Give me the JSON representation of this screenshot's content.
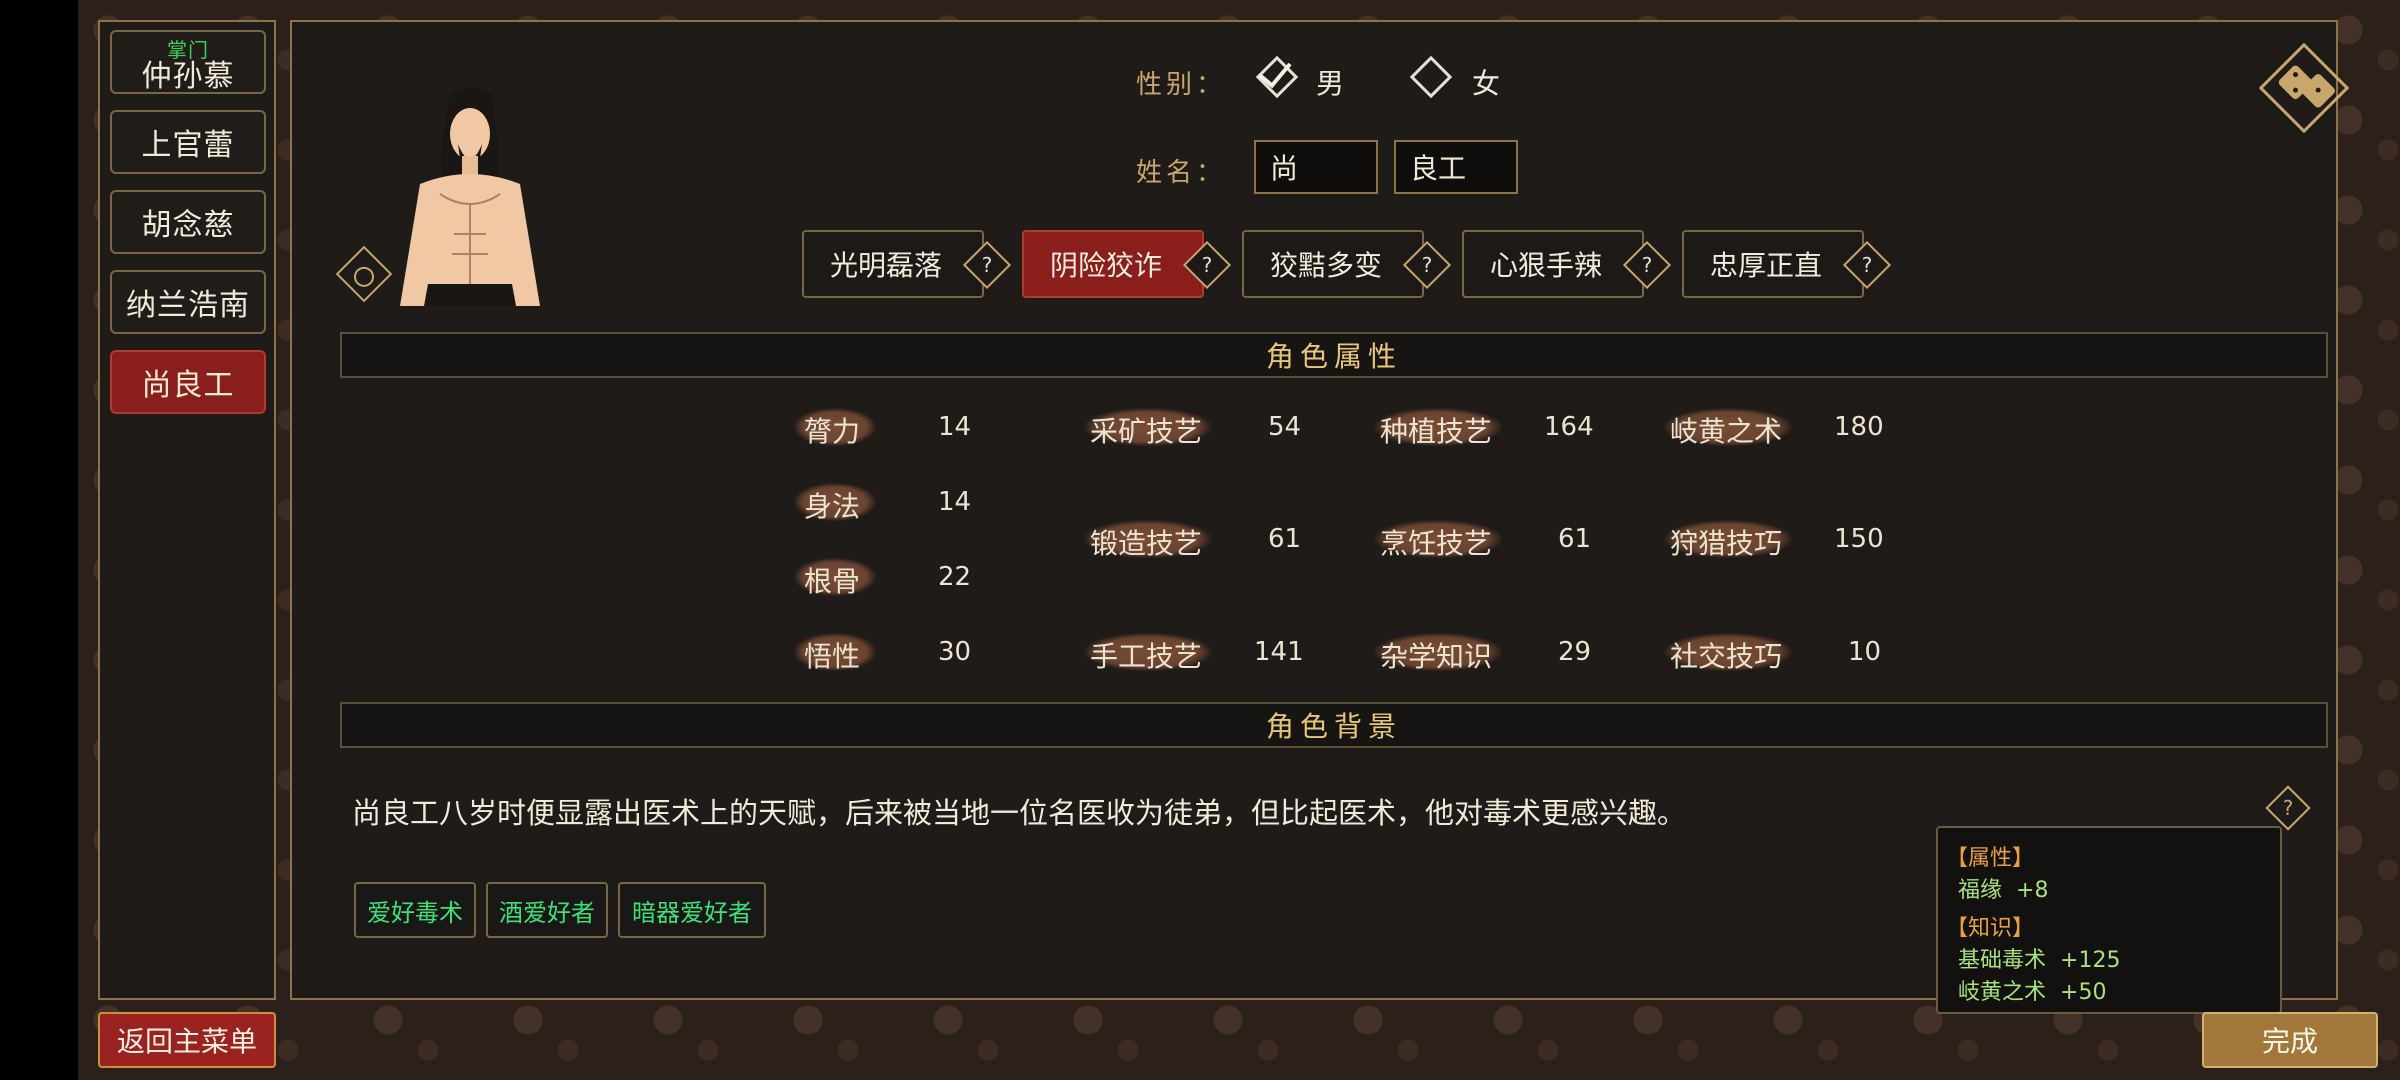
{
  "sidebar": {
    "items": [
      {
        "label": "仲孙慕",
        "tag": "掌门"
      },
      {
        "label": "上官蕾"
      },
      {
        "label": "胡念慈"
      },
      {
        "label": "纳兰浩南"
      },
      {
        "label": "尚良工",
        "active": true
      }
    ]
  },
  "buttons": {
    "back": "返回主菜单",
    "done": "完成"
  },
  "gender": {
    "label": "性别：",
    "options": [
      "男",
      "女"
    ],
    "selected": "男"
  },
  "name": {
    "label": "姓名：",
    "surname": "尚",
    "given": "良工"
  },
  "traits": [
    {
      "label": "光明磊落"
    },
    {
      "label": "阴险狡诈",
      "active": true
    },
    {
      "label": "狡黠多变"
    },
    {
      "label": "心狠手辣"
    },
    {
      "label": "忠厚正直"
    }
  ],
  "sections": {
    "attributes": "角色属性",
    "background": "角色背景"
  },
  "stats": {
    "base": [
      {
        "label": "膂力",
        "value": "14"
      },
      {
        "label": "身法",
        "value": "14"
      },
      {
        "label": "根骨",
        "value": "22"
      },
      {
        "label": "悟性",
        "value": "30"
      }
    ],
    "col2": [
      {
        "label": "采矿技艺",
        "value": "54"
      },
      {
        "label": "锻造技艺",
        "value": "61"
      },
      {
        "label": "手工技艺",
        "value": "141"
      }
    ],
    "col3": [
      {
        "label": "种植技艺",
        "value": "164"
      },
      {
        "label": "烹饪技艺",
        "value": "61"
      },
      {
        "label": "杂学知识",
        "value": "29"
      }
    ],
    "col4": [
      {
        "label": "岐黄之术",
        "value": "180"
      },
      {
        "label": "狩猎技巧",
        "value": "150"
      },
      {
        "label": "社交技巧",
        "value": "10"
      }
    ]
  },
  "background": {
    "text": "尚良工八岁时便显露出医术上的天赋，后来被当地一位名医收为徒弟，但比起医术，他对毒术更感兴趣。",
    "hobbies": [
      "爱好毒术",
      "酒爱好者",
      "暗器爱好者"
    ]
  },
  "tooltip": {
    "attr_head": "【属性】",
    "attr_items": [
      {
        "name": "福缘",
        "value": "+8"
      }
    ],
    "know_head": "【知识】",
    "know_items": [
      {
        "name": "基础毒术",
        "value": "+125"
      },
      {
        "name": "岐黄之术",
        "value": "+50"
      }
    ]
  },
  "icons": [
    "dice-icon",
    "help-icon",
    "avatar-badge-icon",
    "checkbox-icon"
  ],
  "colors": {
    "accent_gold": "#c9a66b",
    "active_red": "#8a1e1c",
    "hobby_green": "#3ce07a"
  }
}
